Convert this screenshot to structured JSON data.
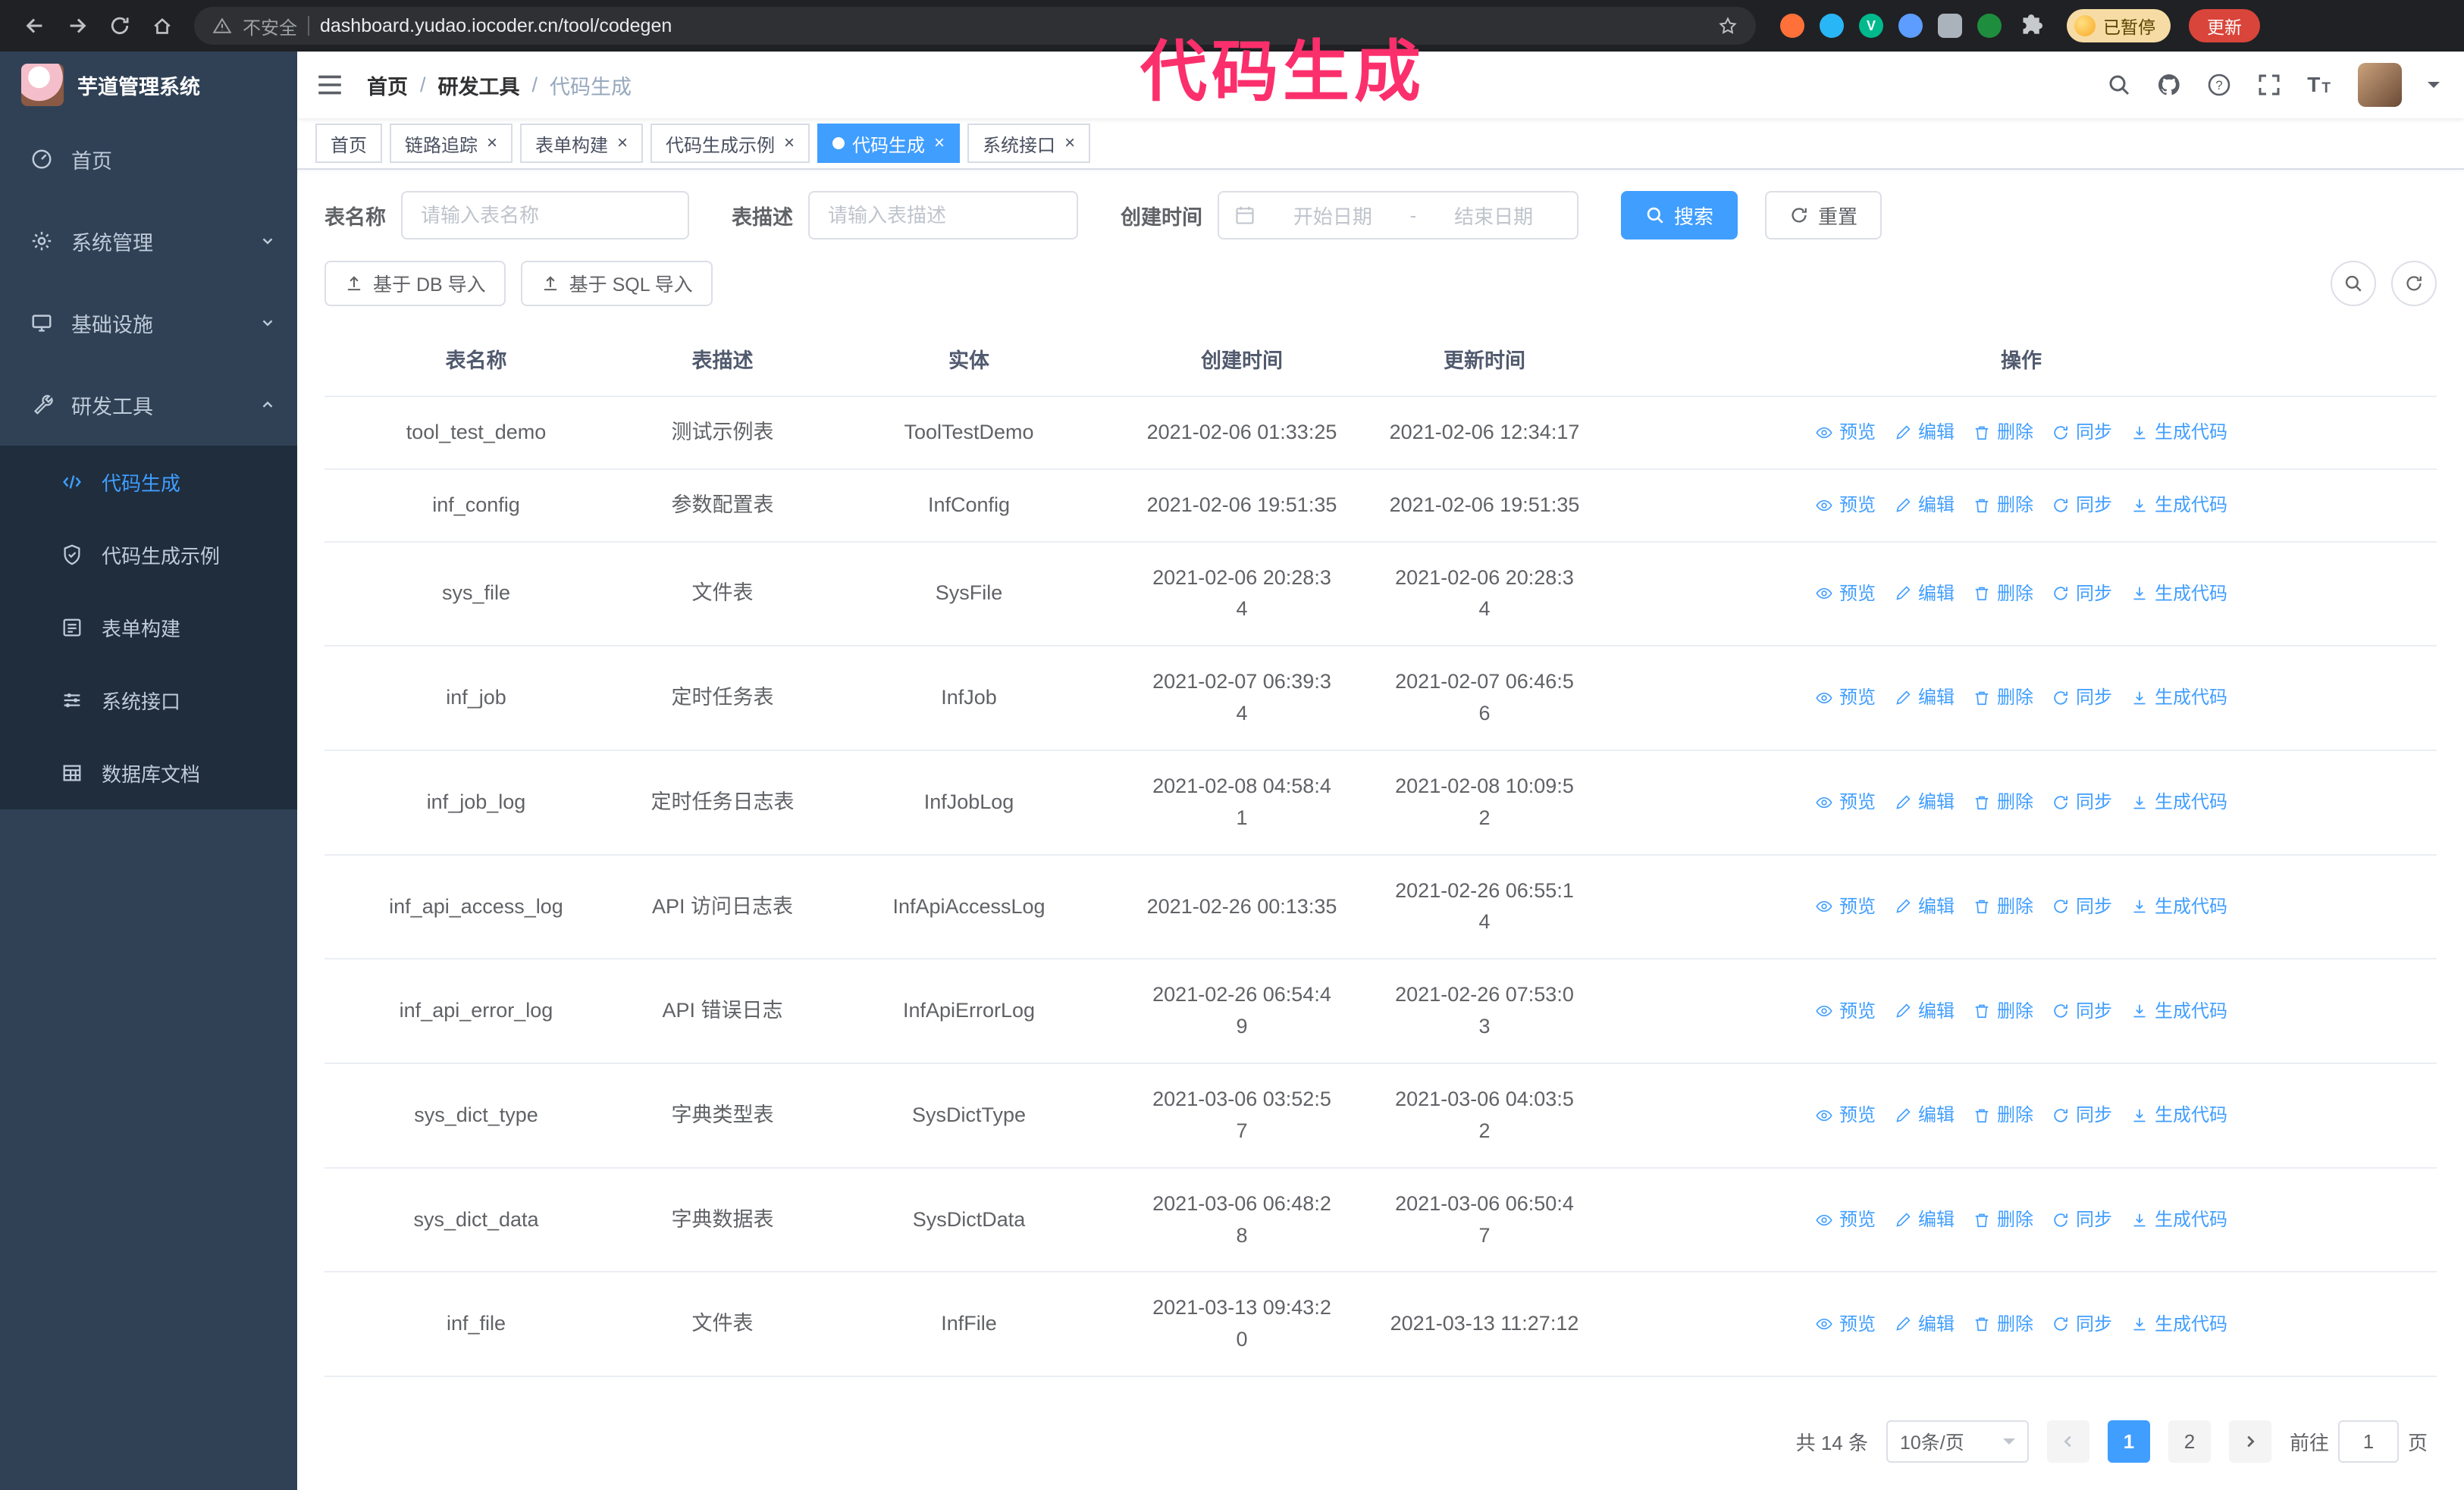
{
  "browser": {
    "security_label": "不安全",
    "url": "dashboard.yudao.iocoder.cn/tool/codegen",
    "paused_badge": "已暂停",
    "update_button": "更新"
  },
  "annotation": {
    "text": "代码生成"
  },
  "icons": {
    "close": "×",
    "breadcrumb_separator": "/",
    "font_size_large": "T",
    "font_size_small": "T"
  },
  "sidebar": {
    "logo_title": "芋道管理系统",
    "menu": [
      "首页",
      "系统管理",
      "基础设施",
      "研发工具"
    ],
    "submenu": [
      "代码生成",
      "代码生成示例",
      "表单构建",
      "系统接口",
      "数据库文档"
    ]
  },
  "header": {
    "breadcrumb": [
      "首页",
      "研发工具",
      "代码生成"
    ]
  },
  "tabs": [
    "首页",
    "链路追踪",
    "表单构建",
    "代码生成示例",
    "代码生成",
    "系统接口"
  ],
  "filters": {
    "table_name_label": "表名称",
    "table_name_placeholder": "请输入表名称",
    "table_desc_label": "表描述",
    "table_desc_placeholder": "请输入表描述",
    "create_time_label": "创建时间",
    "date_start_placeholder": "开始日期",
    "date_separator": "-",
    "date_end_placeholder": "结束日期",
    "search_button": "搜索",
    "reset_button": "重置",
    "import_db_button": "基于 DB 导入",
    "import_sql_button": "基于 SQL 导入"
  },
  "table": {
    "columns": [
      "表名称",
      "表描述",
      "实体",
      "创建时间",
      "更新时间",
      "操作"
    ],
    "action_labels": [
      "预览",
      "编辑",
      "删除",
      "同步",
      "生成代码"
    ],
    "rows": [
      {
        "name": "tool_test_demo",
        "desc": "测试示例表",
        "entity": "ToolTestDemo",
        "created": "2021-02-06 01:33:25",
        "updated": "2021-02-06 12:34:17"
      },
      {
        "name": "inf_config",
        "desc": "参数配置表",
        "entity": "InfConfig",
        "created": "2021-02-06 19:51:35",
        "updated": "2021-02-06 19:51:35"
      },
      {
        "name": "sys_file",
        "desc": "文件表",
        "entity": "SysFile",
        "created": "2021-02-06 20:28:3\n4",
        "updated": "2021-02-06 20:28:3\n4"
      },
      {
        "name": "inf_job",
        "desc": "定时任务表",
        "entity": "InfJob",
        "created": "2021-02-07 06:39:3\n4",
        "updated": "2021-02-07 06:46:5\n6"
      },
      {
        "name": "inf_job_log",
        "desc": "定时任务日志表",
        "entity": "InfJobLog",
        "created": "2021-02-08 04:58:4\n1",
        "updated": "2021-02-08 10:09:5\n2"
      },
      {
        "name": "inf_api_access_log",
        "desc": "API 访问日志表",
        "entity": "InfApiAccessLog",
        "created": "2021-02-26 00:13:35",
        "updated": "2021-02-26 06:55:1\n4"
      },
      {
        "name": "inf_api_error_log",
        "desc": "API 错误日志",
        "entity": "InfApiErrorLog",
        "created": "2021-02-26 06:54:4\n9",
        "updated": "2021-02-26 07:53:0\n3"
      },
      {
        "name": "sys_dict_type",
        "desc": "字典类型表",
        "entity": "SysDictType",
        "created": "2021-03-06 03:52:5\n7",
        "updated": "2021-03-06 04:03:5\n2"
      },
      {
        "name": "sys_dict_data",
        "desc": "字典数据表",
        "entity": "SysDictData",
        "created": "2021-03-06 06:48:2\n8",
        "updated": "2021-03-06 06:50:4\n7"
      },
      {
        "name": "inf_file",
        "desc": "文件表",
        "entity": "InfFile",
        "created": "2021-03-13 09:43:2\n0",
        "updated": "2021-03-13 11:27:12"
      }
    ]
  },
  "pagination": {
    "total_text": "共 14 条",
    "page_size": "10条/页",
    "pages": [
      "1",
      "2"
    ],
    "goto_label": "前往",
    "goto_value": "1",
    "goto_suffix": "页"
  },
  "colors": {
    "primary": "#409EFF",
    "sidebar_bg": "#304156",
    "sidebar_submenu_bg": "#1F2D3D",
    "annotation_pink": "#FB2F6C",
    "browser_bar_bg": "#202124",
    "update_button_red": "#D9453A",
    "table_border": "#EBEEF5"
  }
}
